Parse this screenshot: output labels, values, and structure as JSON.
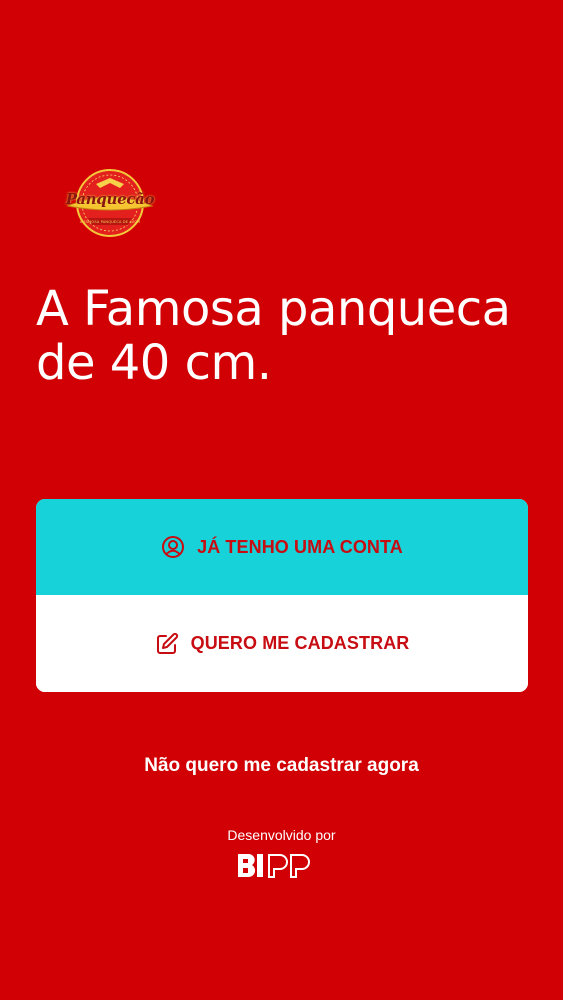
{
  "logo": {
    "brand": "Panquecão",
    "tagline": "A FAMOSA PANQUECA DE 40CM"
  },
  "headline": "A Famosa panqueca de 40 cm.",
  "buttons": {
    "login_label": "JÁ TENHO UMA CONTA",
    "login_icon": "user-circle-icon",
    "signup_label": "QUERO ME CADASTRAR",
    "signup_icon": "edit-icon"
  },
  "skip_link": "Não quero me cadastrar agora",
  "footer": {
    "developed_by": "Desenvolvido por",
    "developer_brand": "BIPP"
  },
  "colors": {
    "background": "#d10004",
    "login_button": "#17d2d8",
    "signup_button": "#ffffff",
    "button_text": "#c70c12",
    "text": "#ffffff"
  }
}
